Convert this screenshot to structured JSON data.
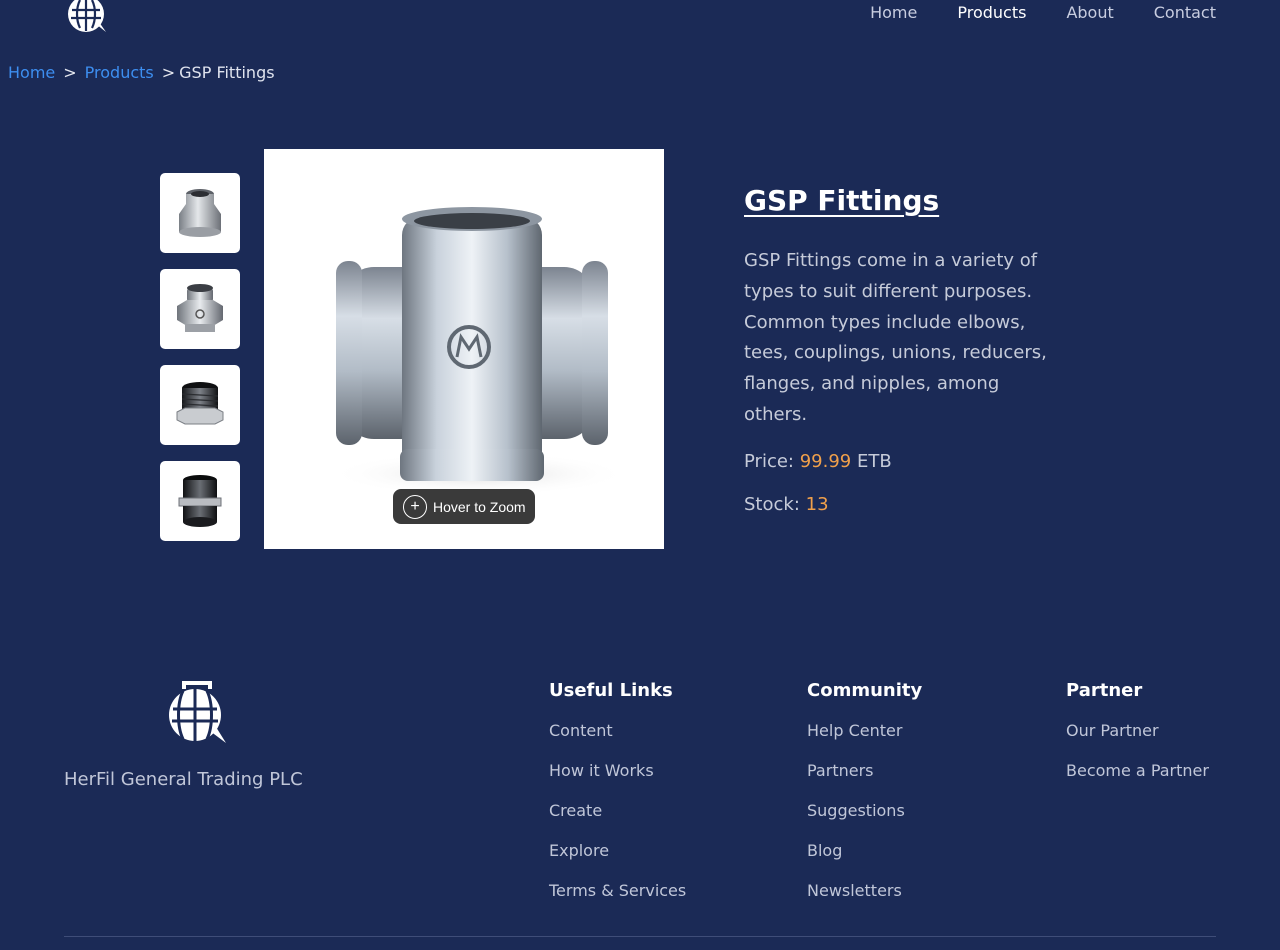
{
  "header": {
    "logo_icon": "herfil-globe-logo-icon",
    "nav": [
      {
        "label": "Home",
        "active": false
      },
      {
        "label": "Products",
        "active": true
      },
      {
        "label": "About",
        "active": false
      },
      {
        "label": "Contact",
        "active": false
      }
    ]
  },
  "breadcrumb": {
    "home": "Home",
    "sep1": ">",
    "products": "Products",
    "sep2": ">",
    "current": "GSP Fittings"
  },
  "gallery": {
    "thumbnails": [
      {
        "icon": "reducer-fitting-icon"
      },
      {
        "icon": "union-fitting-icon"
      },
      {
        "icon": "threaded-bushing-icon"
      },
      {
        "icon": "pipe-nipple-icon"
      }
    ],
    "main_icon": "cross-fitting-icon",
    "zoom_hint": "Hover to Zoom",
    "zoom_symbol": "+"
  },
  "product": {
    "title": "GSP Fittings",
    "description": "GSP Fittings come in a variety of types to suit different purposes. Common types include elbows, tees, couplings, unions, reducers, flanges, and nipples, among others.",
    "price_label": "Price:",
    "price_value": "99.99",
    "price_currency": "ETB",
    "stock_label": "Stock:",
    "stock_value": "13"
  },
  "footer": {
    "company": "HerFil General Trading PLC",
    "columns": [
      {
        "title": "Useful Links",
        "links": [
          "Content",
          "How it Works",
          "Create",
          "Explore",
          "Terms & Services"
        ]
      },
      {
        "title": "Community",
        "links": [
          "Help Center",
          "Partners",
          "Suggestions",
          "Blog",
          "Newsletters"
        ]
      },
      {
        "title": "Partner",
        "links": [
          "Our Partner",
          "Become a Partner"
        ]
      }
    ]
  },
  "colors": {
    "background": "#1b2a56",
    "link_blue": "#3d8ef0",
    "accent_orange": "#f0a04b",
    "muted_text": "#c6cbd9"
  }
}
